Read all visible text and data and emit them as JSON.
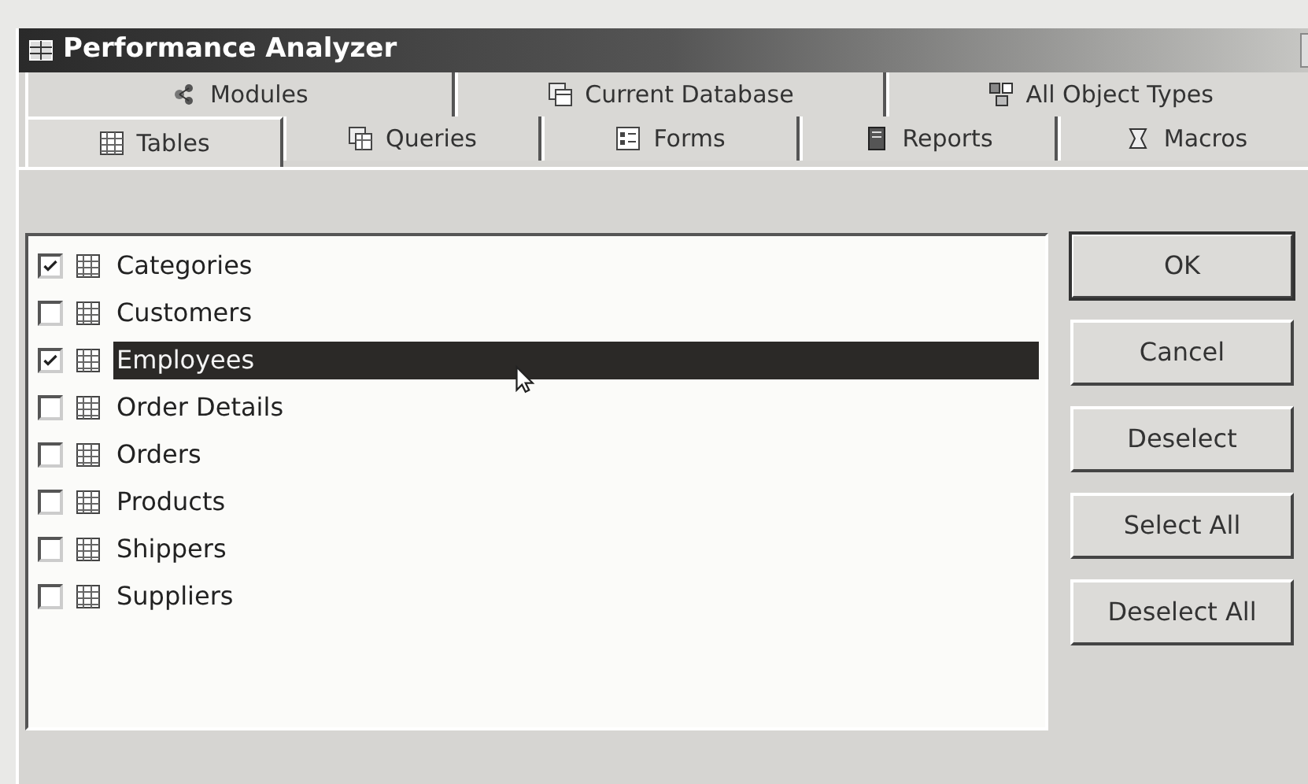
{
  "window": {
    "title": "Performance Analyzer"
  },
  "tab_rows": [
    {
      "tabs": [
        {
          "label": "Modules",
          "selected": false
        },
        {
          "label": "Current Database",
          "selected": false
        },
        {
          "label": "All Object Types",
          "selected": false
        }
      ]
    },
    {
      "tabs": [
        {
          "label": "Tables",
          "selected": true
        },
        {
          "label": "Queries",
          "selected": false
        },
        {
          "label": "Forms",
          "selected": false
        },
        {
          "label": "Reports",
          "selected": false
        },
        {
          "label": "Macros",
          "selected": false
        }
      ]
    }
  ],
  "items": [
    {
      "label": "Categories",
      "checked": true,
      "selected": false
    },
    {
      "label": "Customers",
      "checked": false,
      "selected": false
    },
    {
      "label": "Employees",
      "checked": true,
      "selected": true
    },
    {
      "label": "Order Details",
      "checked": false,
      "selected": false
    },
    {
      "label": "Orders",
      "checked": false,
      "selected": false
    },
    {
      "label": "Products",
      "checked": false,
      "selected": false
    },
    {
      "label": "Shippers",
      "checked": false,
      "selected": false
    },
    {
      "label": "Suppliers",
      "checked": false,
      "selected": false
    }
  ],
  "buttons": [
    {
      "label": "OK",
      "default": true
    },
    {
      "label": "Cancel",
      "default": false
    },
    {
      "label": "Deselect",
      "default": false
    },
    {
      "label": "Select All",
      "default": false
    },
    {
      "label": "Deselect All",
      "default": false
    }
  ]
}
